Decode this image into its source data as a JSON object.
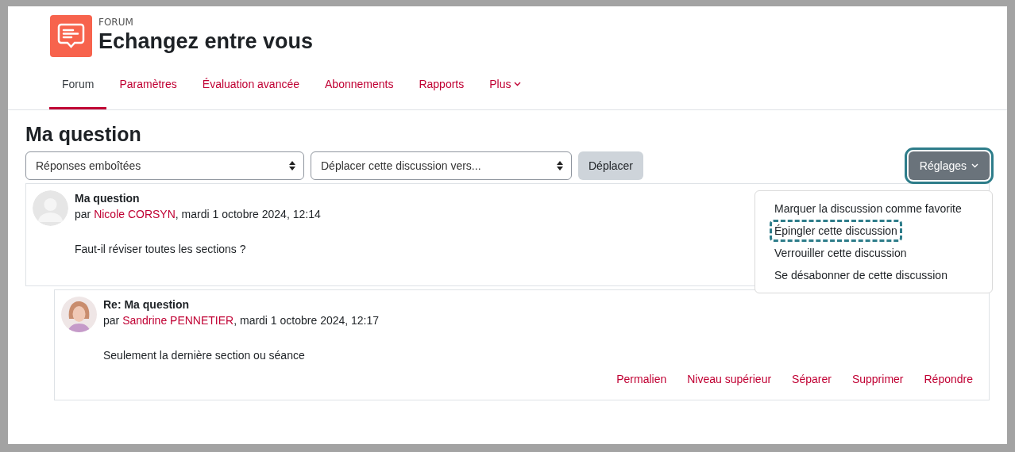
{
  "header": {
    "kicker": "FORUM",
    "title": "Echangez entre vous"
  },
  "tabs": [
    {
      "label": "Forum",
      "selected": true,
      "dropdown": false
    },
    {
      "label": "Paramètres",
      "selected": false,
      "dropdown": false
    },
    {
      "label": "Évaluation avancée",
      "selected": false,
      "dropdown": false
    },
    {
      "label": "Abonnements",
      "selected": false,
      "dropdown": false
    },
    {
      "label": "Rapports",
      "selected": false,
      "dropdown": false
    },
    {
      "label": "Plus",
      "selected": false,
      "dropdown": true
    }
  ],
  "discussion_title": "Ma question",
  "display_select": {
    "value": "Réponses emboîtées"
  },
  "move_select": {
    "value": "Déplacer cette discussion vers..."
  },
  "move_button": "Déplacer",
  "settings_button": {
    "label": "Réglages",
    "highlighted": true
  },
  "settings_menu": [
    {
      "label": "Marquer la discussion comme favorite",
      "highlighted": false
    },
    {
      "label": "Épingler cette discussion",
      "highlighted": true
    },
    {
      "label": "Verrouiller cette discussion",
      "highlighted": false
    },
    {
      "label": "Se désabonner de cette discussion",
      "highlighted": false
    }
  ],
  "posts": [
    {
      "subject": "Ma question",
      "by": "par",
      "author": "Nicole CORSYN",
      "date": ", mardi 1 octobre 2024, 12:14",
      "body": "Faut-il réviser toutes les sections ?",
      "kind": "placeholder",
      "reply": false
    },
    {
      "subject": "Re: Ma question",
      "by": "par",
      "author": "Sandrine PENNETIER",
      "date": ", mardi 1 octobre 2024, 12:17",
      "body": "Seulement la dernière section ou séance",
      "kind": "picture",
      "reply": true,
      "actions": [
        "Permalien",
        "Niveau supérieur",
        "Séparer",
        "Supprimer",
        "Répondre"
      ]
    }
  ]
}
